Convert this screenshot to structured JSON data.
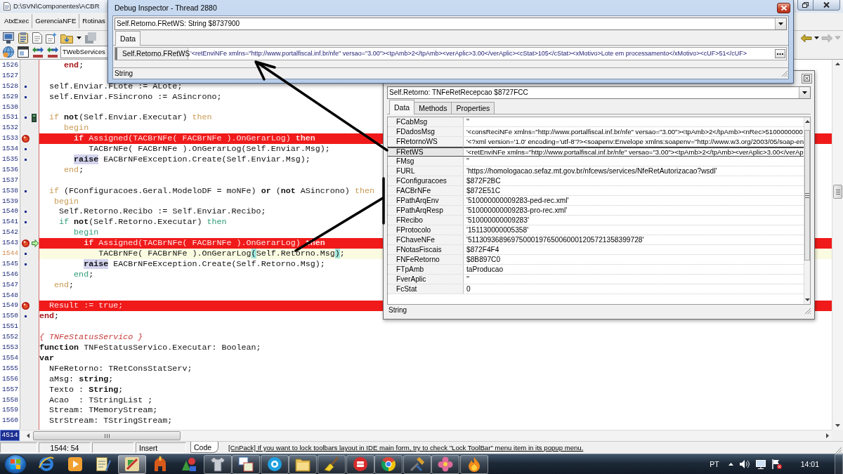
{
  "ide": {
    "title": "D:\\SVN\\Componentes\\ACBR",
    "tabs": [
      {
        "label": "AtxExec",
        "selected": false
      },
      {
        "label": "GerenciaNFE",
        "selected": false
      },
      {
        "label": "Rotinas",
        "selected": false
      }
    ],
    "class_combo": "TWebServices",
    "navigation": [
      {
        "kind": "back",
        "disabled": false
      },
      {
        "kind": "forward",
        "disabled": true
      }
    ]
  },
  "editor": {
    "lines": [
      {
        "number": "1526",
        "kind": "plain",
        "dot": false,
        "segments": [
          {
            "text": "     end",
            "kind": "block0"
          },
          {
            "text": ";",
            "kind": "text"
          }
        ]
      },
      {
        "number": "1527",
        "kind": "plain",
        "dot": false
      },
      {
        "number": "1528",
        "kind": "plain",
        "dot": true,
        "segments": [
          {
            "text": "  self.Enviar.FLote := ALote;",
            "kind": "text"
          }
        ]
      },
      {
        "number": "1529",
        "kind": "plain",
        "dot": true,
        "segments": [
          {
            "text": "  self.Enviar.FSincrono := ASincrono;",
            "kind": "text"
          }
        ]
      },
      {
        "number": "1530",
        "kind": "plain",
        "dot": false
      },
      {
        "number": "1531",
        "kind": "plain",
        "dot": true,
        "gutter_mark": {
          "kind": "bookmark"
        },
        "segments": [
          {
            "text": "  if",
            "kind": "block1"
          },
          {
            "text": " not",
            "kind": "reserved"
          },
          {
            "text": "(Self.Enviar.Executar) ",
            "kind": "text"
          },
          {
            "text": "then",
            "kind": "block1"
          }
        ]
      },
      {
        "number": "1532",
        "kind": "plain",
        "dot": false,
        "segments": [
          {
            "text": "     begin",
            "kind": "block1"
          }
        ]
      },
      {
        "number": "1533",
        "kind": "breakpoint",
        "segments": [
          {
            "text": "       if",
            "kind": "reserved"
          },
          {
            "text": " Assigned(TACBrNFe( FACBrNFe ).OnGerarLog) ",
            "kind": "text"
          },
          {
            "text": "then",
            "kind": "reserved"
          }
        ]
      },
      {
        "number": "1534",
        "kind": "plain",
        "dot": true,
        "segments": [
          {
            "text": "          TACBrNFe( FACBrNFe ).OnGerarLog(Self.Enviar.Msg);",
            "kind": "text"
          }
        ]
      },
      {
        "number": "1535",
        "kind": "plain",
        "dot": true,
        "segments": [
          {
            "text": "       raise",
            "kind": "marked"
          },
          {
            "text": " EACBrNFeException.Create(Self.Enviar.Msg);",
            "kind": "text"
          }
        ]
      },
      {
        "number": "1536",
        "kind": "plain",
        "dot": false,
        "segments": [
          {
            "text": "     end",
            "kind": "block1"
          },
          {
            "text": ";",
            "kind": "text"
          }
        ]
      },
      {
        "number": "1537",
        "kind": "plain",
        "dot": false
      },
      {
        "number": "1538",
        "kind": "plain",
        "dot": true,
        "segments": [
          {
            "text": "  if",
            "kind": "block1"
          },
          {
            "text": " (FConfiguracoes.Geral.ModeloDF = moNFe) ",
            "kind": "text"
          },
          {
            "text": "or",
            "kind": "reserved"
          },
          {
            "text": " (",
            "kind": "text"
          },
          {
            "text": "not",
            "kind": "reserved"
          },
          {
            "text": " ASincrono) ",
            "kind": "text"
          },
          {
            "text": "then",
            "kind": "block1"
          }
        ]
      },
      {
        "number": "1539",
        "kind": "plain",
        "dot": false,
        "segments": [
          {
            "text": "   begin",
            "kind": "block1"
          }
        ]
      },
      {
        "number": "1540",
        "kind": "plain",
        "dot": true,
        "segments": [
          {
            "text": "    Self.Retorno.Recibo := Self.Enviar.Recibo;",
            "kind": "text"
          }
        ]
      },
      {
        "number": "1541",
        "kind": "plain",
        "dot": true,
        "segments": [
          {
            "text": "    if",
            "kind": "block2"
          },
          {
            "text": " not",
            "kind": "reserved"
          },
          {
            "text": "(Self.Retorno.Executar) ",
            "kind": "text"
          },
          {
            "text": "then",
            "kind": "block2"
          }
        ]
      },
      {
        "number": "1542",
        "kind": "plain",
        "dot": false,
        "segments": [
          {
            "text": "       begin",
            "kind": "block2"
          }
        ]
      },
      {
        "number": "1543",
        "kind": "breakpoint",
        "gutter_mark": {
          "kind": "execution-point"
        },
        "segments": [
          {
            "text": "         if",
            "kind": "reserved"
          },
          {
            "text": " Assigned(TACBrNFe( FACBrNFe ).OnGerarLog) ",
            "kind": "text"
          },
          {
            "text": "then",
            "kind": "reserved"
          }
        ]
      },
      {
        "number": "1544",
        "kind": "current",
        "dot": true,
        "segments": [
          {
            "text": "            TACBrNFe( FACBrNFe ).OnGerarLog",
            "kind": "text"
          },
          {
            "text": "(",
            "kind": "bracket"
          },
          {
            "text": "Self.Retorno.Msg",
            "kind": "text"
          },
          {
            "text": ")",
            "kind": "bracket"
          },
          {
            "text": ";",
            "kind": "text"
          }
        ]
      },
      {
        "number": "1545",
        "kind": "plain",
        "dot": true,
        "segments": [
          {
            "text": "         raise",
            "kind": "marked"
          },
          {
            "text": " EACBrNFeException.Create(Self.Retorno.Msg);",
            "kind": "text"
          }
        ]
      },
      {
        "number": "1546",
        "kind": "plain",
        "dot": false,
        "segments": [
          {
            "text": "       end",
            "kind": "block2"
          },
          {
            "text": ";",
            "kind": "text"
          }
        ]
      },
      {
        "number": "1547",
        "kind": "plain",
        "dot": false,
        "segments": [
          {
            "text": "   end",
            "kind": "block1"
          },
          {
            "text": ";",
            "kind": "text"
          }
        ]
      },
      {
        "number": "1548",
        "kind": "plain",
        "dot": false
      },
      {
        "number": "1549",
        "kind": "breakpoint",
        "segments": [
          {
            "text": "  Result := true;",
            "kind": "text"
          }
        ]
      },
      {
        "number": "1550",
        "kind": "plain",
        "dot": true,
        "segments": [
          {
            "text": "end",
            "kind": "block0"
          },
          {
            "text": ";",
            "kind": "text"
          }
        ]
      },
      {
        "number": "1551",
        "kind": "plain",
        "dot": false
      },
      {
        "number": "1552",
        "kind": "plain",
        "dot": false,
        "segments": [
          {
            "text": "{ TNFeStatusServico }",
            "kind": "comment"
          }
        ]
      },
      {
        "number": "1553",
        "kind": "plain",
        "dot": false,
        "segments": [
          {
            "text": "function",
            "kind": "reserved"
          },
          {
            "text": " TNFeStatusServico.Executar: Boolean;",
            "kind": "text"
          }
        ]
      },
      {
        "number": "1554",
        "kind": "plain",
        "dot": false,
        "segments": [
          {
            "text": "var",
            "kind": "reserved"
          }
        ]
      },
      {
        "number": "1555",
        "kind": "plain",
        "dot": false,
        "segments": [
          {
            "text": "  NFeRetorno: TRetConsStatServ;",
            "kind": "text"
          }
        ]
      },
      {
        "number": "1556",
        "kind": "plain",
        "dot": false,
        "segments": [
          {
            "text": "  aMsg: ",
            "kind": "text"
          },
          {
            "text": "string",
            "kind": "reserved"
          },
          {
            "text": ";",
            "kind": "text"
          }
        ]
      },
      {
        "number": "1557",
        "kind": "plain",
        "dot": false,
        "segments": [
          {
            "text": "  Texto : ",
            "kind": "text"
          },
          {
            "text": "String",
            "kind": "reserved"
          },
          {
            "text": ";",
            "kind": "text"
          }
        ]
      },
      {
        "number": "1558",
        "kind": "plain",
        "dot": false,
        "segments": [
          {
            "text": "  Acao  : TStringList ;",
            "kind": "text"
          }
        ]
      },
      {
        "number": "1559",
        "kind": "plain",
        "dot": false,
        "segments": [
          {
            "text": "  Stream: TMemoryStream;",
            "kind": "text"
          }
        ]
      },
      {
        "number": "1560",
        "kind": "plain",
        "dot": false,
        "segments": [
          {
            "text": "  StrStream: TStringStream;",
            "kind": "text"
          }
        ]
      }
    ],
    "line_count": "4514"
  },
  "status_bar": {
    "position": "1544: 54",
    "mode": "Insert",
    "view_tabs": [
      {
        "label": "Code",
        "selected": true
      }
    ],
    "hint": "[CnPack] If you want to lock toolbars layout in IDE main form, try to check \"Lock ToolBar\" menu item in its popup menu."
  },
  "debug_inspector": {
    "title": "Debug Inspector - Thread 2880",
    "expression": "Self.Retorno.FRetWS: String $8737900",
    "tabs": [
      {
        "label": "Data",
        "selected": true
      }
    ],
    "rows": [
      {
        "name": "Self.Retorno.FRetWS",
        "value": "'<retEnviNFe xmlns=\"http://www.portalfiscal.inf.br/nfe\" versao=\"3.00\"><tpAmb>2</tpAmb><verAplic>3.00</verAplic><cStat>105</cStat><xMotivo>Lote em processamento</xMotivo><cUF>51</cUF>"
      }
    ],
    "status": "String"
  },
  "inspector": {
    "expression": "Self.Retorno: TNFeRetRecepcao $8727FCC",
    "tabs": [
      {
        "label": "Data",
        "selected": true
      },
      {
        "label": "Methods",
        "selected": false
      },
      {
        "label": "Properties",
        "selected": false
      }
    ],
    "rows": [
      {
        "name": "FCabMsg",
        "value": "''",
        "selected": false
      },
      {
        "name": "FDadosMsg",
        "value": "'<consReciNFe xmlns=\"http://www.portalfiscal.inf.br/nfe\" versao=\"3.00\"><tpAmb>2</tpAmb><nRec>5100000000",
        "selected": false
      },
      {
        "name": "FRetornoWS",
        "value": "'<?xml version='1.0' encoding='utf-8'?><soapenv:Envelope xmlns:soapenv=\"http://www.w3.org/2003/05/soap-en",
        "selected": false
      },
      {
        "name": "FRetWS",
        "value": "'<retEnviNFe xmlns=\"http://www.portalfiscal.inf.br/nfe\" versao=\"3.00\"><tpAmb>2</tpAmb><verAplic>3.00</verAp",
        "selected": true
      },
      {
        "name": "FMsg",
        "value": "''",
        "selected": false
      },
      {
        "name": "FURL",
        "value": "'https://homologacao.sefaz.mt.gov.br/nfcews/services/NfeRetAutorizacao?wsdl'",
        "selected": false
      },
      {
        "name": "FConfiguracoes",
        "value": "$872F2BC",
        "selected": false
      },
      {
        "name": "FACBrNFe",
        "value": "$872E51C",
        "selected": false
      },
      {
        "name": "FPathArqEnv",
        "value": "'510000000009283-ped-rec.xml'",
        "selected": false
      },
      {
        "name": "FPathArqResp",
        "value": "'510000000009283-pro-rec.xml'",
        "selected": false
      },
      {
        "name": "FRecibo",
        "value": "'510000000009283'",
        "selected": false
      },
      {
        "name": "FProtocolo",
        "value": "'151130000005358'",
        "selected": false
      },
      {
        "name": "FChaveNFe",
        "value": "'51130936896975000197650060001205721358399728'",
        "selected": false
      },
      {
        "name": "FNotasFiscais",
        "value": "$872F4F4",
        "selected": false
      },
      {
        "name": "FNFeRetorno",
        "value": "$8B897C0",
        "selected": false
      },
      {
        "name": "FTpAmb",
        "value": "taProducao",
        "selected": false
      },
      {
        "name": "FverAplic",
        "value": "''",
        "selected": false
      },
      {
        "name": "FcStat",
        "value": "0",
        "selected": false
      }
    ],
    "status": "String"
  },
  "taskbar": {
    "apps": [
      {
        "kind": "browser",
        "running": false,
        "active": false
      },
      {
        "kind": "media",
        "running": false,
        "active": false
      },
      {
        "kind": "notes",
        "running": false,
        "active": false
      },
      {
        "kind": "delphi",
        "running": true,
        "active": true
      },
      {
        "kind": "helmet",
        "running": false,
        "active": false
      },
      {
        "kind": "shapes",
        "running": false,
        "active": false
      },
      {
        "kind": "shirt",
        "running": true,
        "active": false
      },
      {
        "kind": "panes",
        "running": true,
        "active": false
      },
      {
        "kind": "chat",
        "running": true,
        "active": false
      },
      {
        "kind": "folder",
        "running": true,
        "active": false
      },
      {
        "kind": "broom",
        "running": true,
        "active": false
      },
      {
        "kind": "record",
        "running": true,
        "active": false
      },
      {
        "kind": "wheel",
        "running": true,
        "active": false
      },
      {
        "kind": "tools",
        "running": true,
        "active": false
      },
      {
        "kind": "flower",
        "running": true,
        "active": false
      },
      {
        "kind": "flame",
        "running": true,
        "active": false
      }
    ],
    "language": "PT",
    "clock": "14:01"
  }
}
